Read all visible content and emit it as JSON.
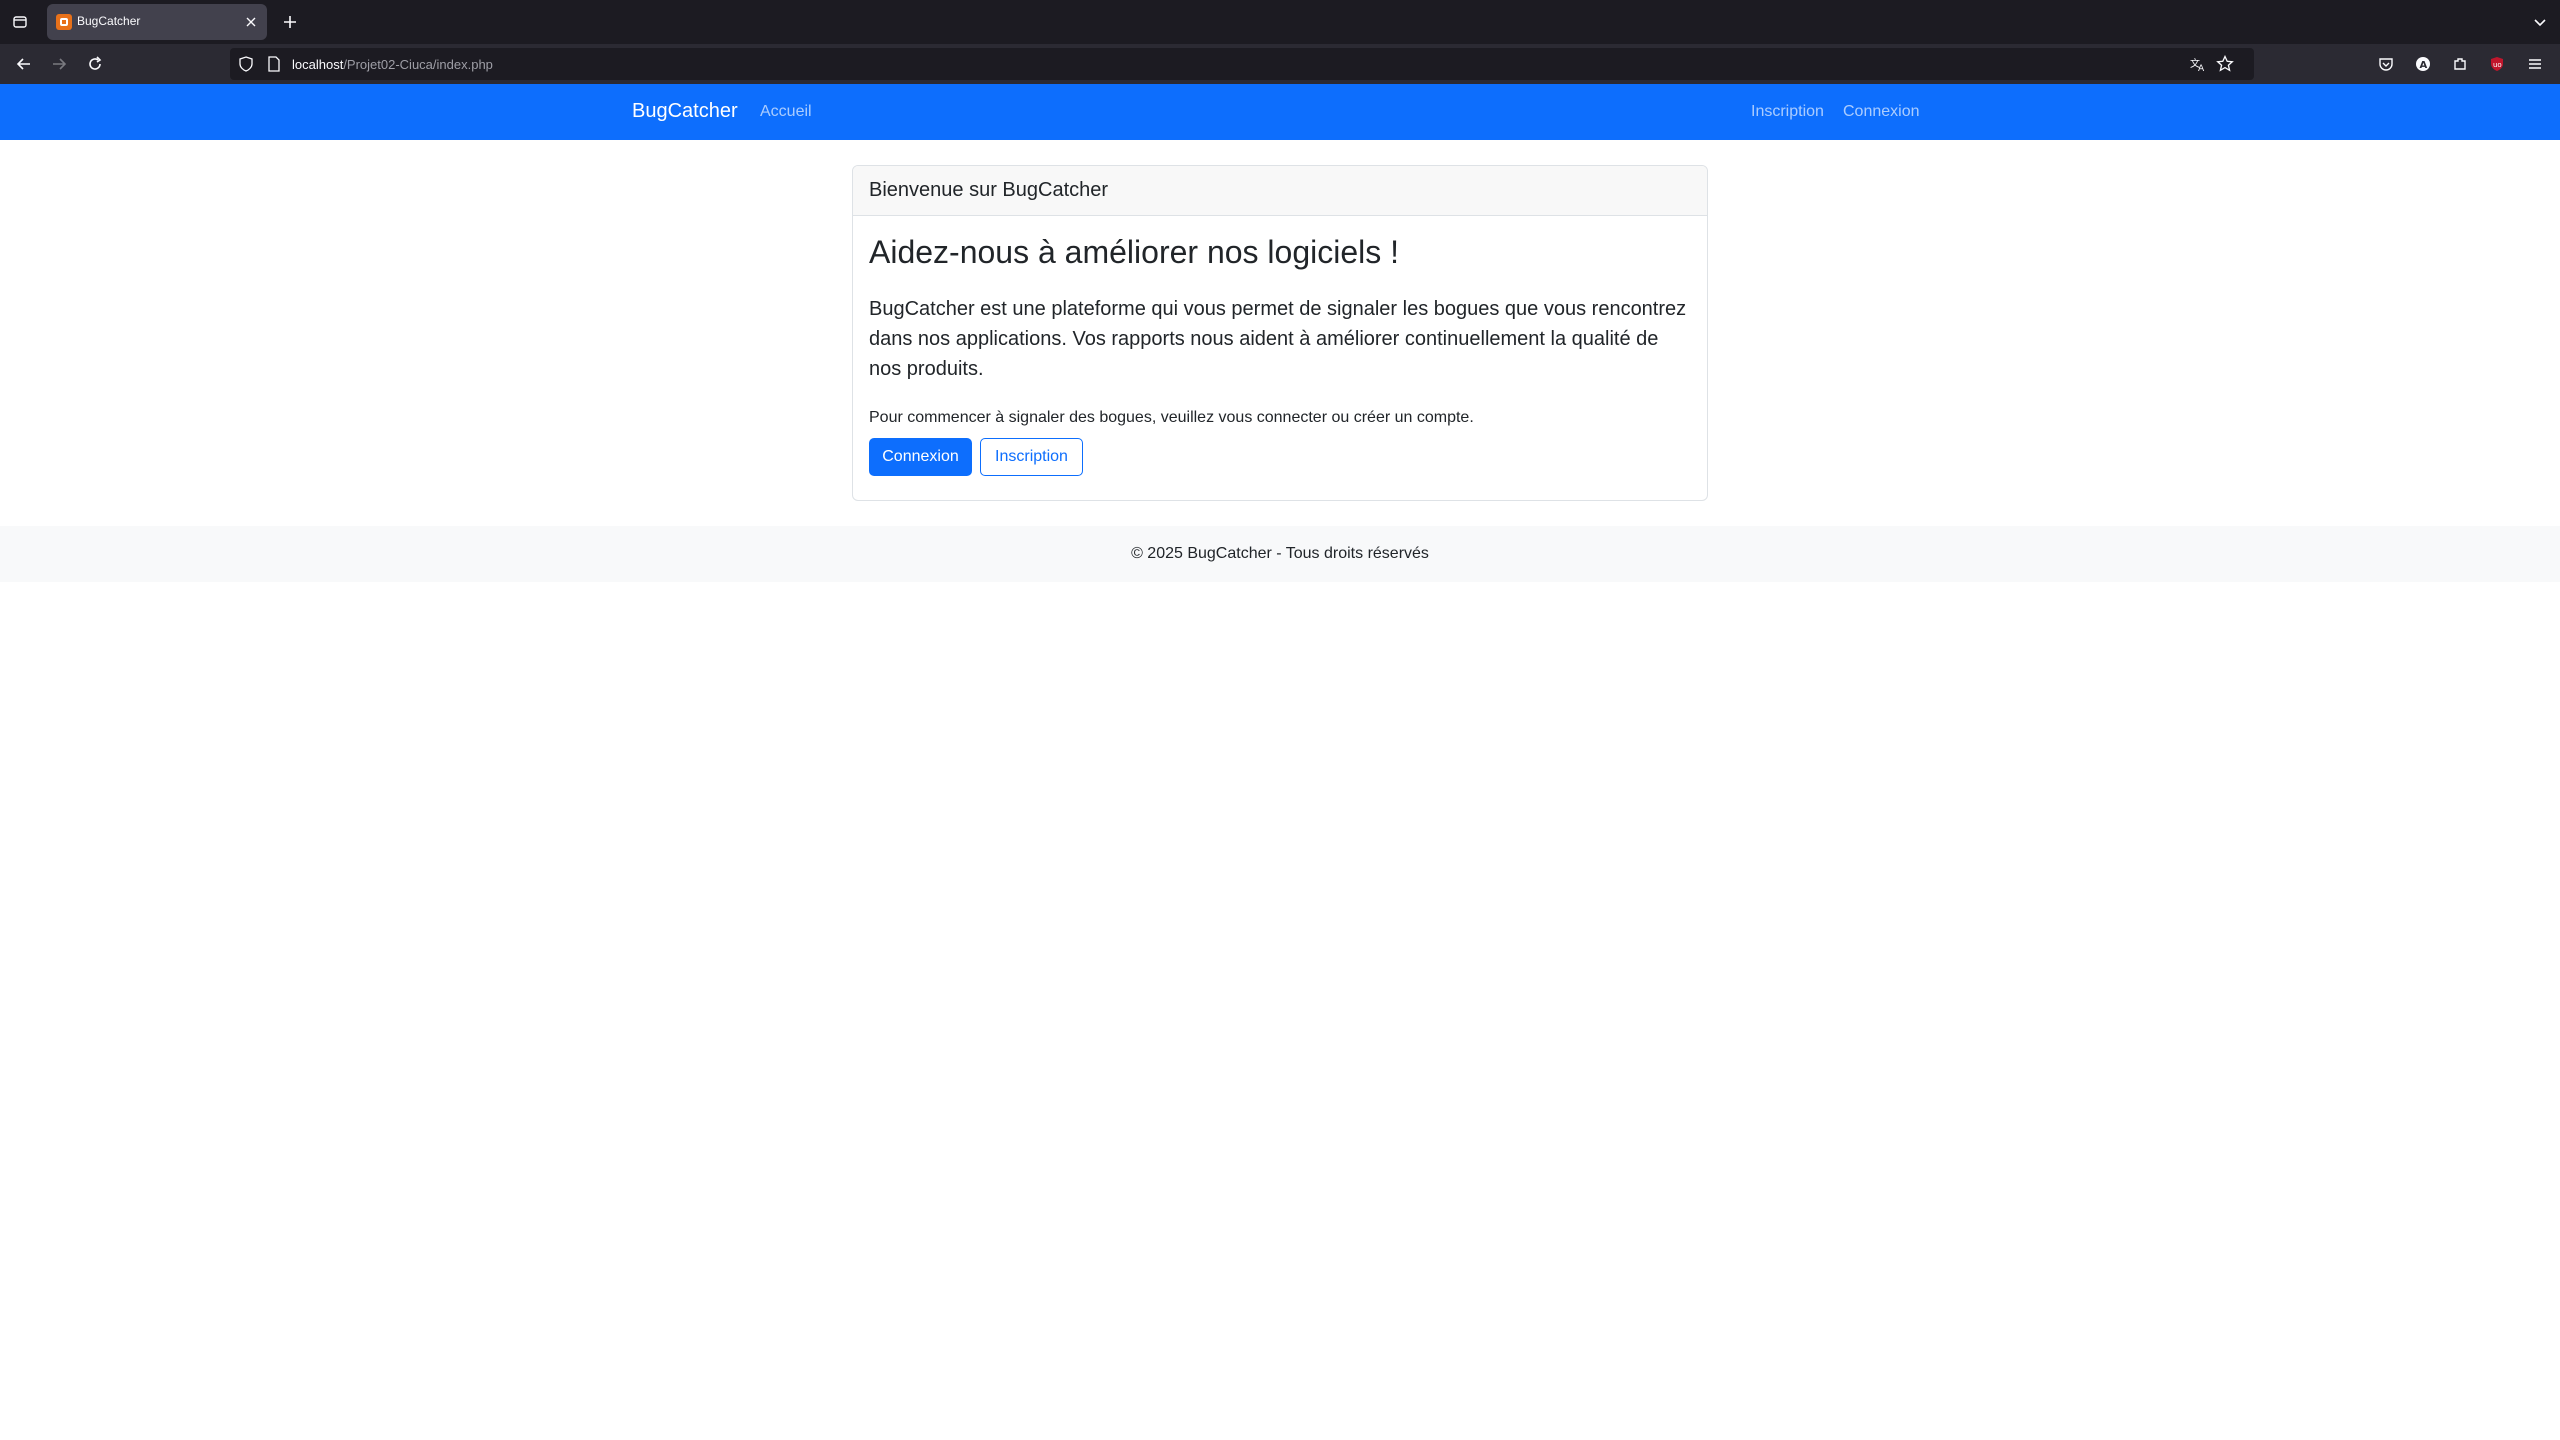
{
  "browser": {
    "tab_title": "BugCatcher",
    "url_host": "localhost",
    "url_path": "/Projet02-Ciuca/index.php"
  },
  "site_nav": {
    "brand": "BugCatcher",
    "home": "Accueil",
    "register": "Inscription",
    "login": "Connexion"
  },
  "card": {
    "header": "Bienvenue sur BugCatcher",
    "title": "Aidez-nous à améliorer nos logiciels !",
    "lead": "BugCatcher est une plateforme qui vous permet de signaler les bogues que vous rencontrez dans nos applications. Vos rapports nous aident à améliorer continuellement la qualité de nos produits.",
    "note": "Pour commencer à signaler des bogues, veuillez vous connecter ou créer un compte.",
    "login_button": "Connexion",
    "register_button": "Inscription"
  },
  "footer": {
    "text": "© 2025 BugCatcher - Tous droits réservés"
  },
  "colors": {
    "primary": "#0d6efd",
    "chrome_dark": "#1c1b22",
    "chrome_toolbar": "#2b2a33"
  }
}
